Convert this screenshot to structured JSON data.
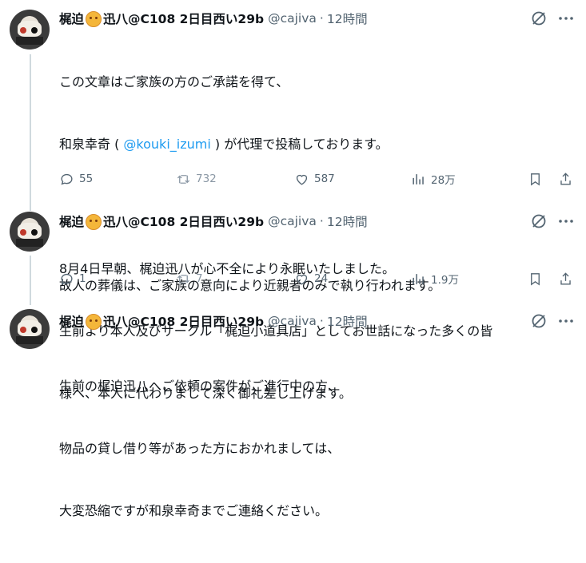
{
  "tweets": [
    {
      "display_name": "梶迫",
      "display_name_rest": "迅八@C108 2日目西い29b",
      "handle": "@cajiva",
      "sep": "·",
      "time": "12時間",
      "body_line1": "この文章はご家族の方のご承諾を得て、",
      "body_line2_pre": "和泉幸奇 ( ",
      "body_line2_mention": "@kouki_izumi",
      "body_line2_post": " ) が代理で投稿しております。",
      "body_line3": "",
      "body_line4": "8月4日早朝、梶迫迅八が心不全により永眠いたしました。",
      "body_line5": "生前より本人及びサークル「梶迫小道具店」としてお世話になった多くの皆",
      "body_line6": "様へ、本人に代わりまして深く御礼差し上げます。",
      "replies": "55",
      "retweets": "732",
      "likes": "587",
      "views": "28万"
    },
    {
      "display_name": "梶迫",
      "display_name_rest": "迅八@C108 2日目西い29b",
      "handle": "@cajiva",
      "sep": "·",
      "time": "12時間",
      "body_line1": "故人の葬儀は、ご家族の意向により近親者のみで執り行われます。",
      "replies": "1",
      "retweets": "7",
      "likes": "24",
      "views": "1.9万"
    },
    {
      "display_name": "梶迫",
      "display_name_rest": "迅八@C108 2日目西い29b",
      "handle": "@cajiva",
      "sep": "·",
      "time": "12時間",
      "body_line1": "生前の梶迫迅八へご依頼の案件がご進行中の方、",
      "body_line2": "物品の貸し借り等があった方におかれましては、",
      "body_line3": "大変恐縮ですが和泉幸奇までご連絡ください。"
    }
  ],
  "icons": {
    "grok": "grok-slash-circle-icon",
    "more": "more-dots-icon",
    "reply": "reply-bubble-icon",
    "retweet": "retweet-icon",
    "like": "heart-icon",
    "views": "bar-chart-icon",
    "bookmark": "bookmark-icon",
    "share": "share-icon"
  },
  "colors": {
    "text": "#0f1419",
    "muted": "#536471",
    "mention": "#1d9bf0",
    "thread_line": "#cfd9de"
  }
}
